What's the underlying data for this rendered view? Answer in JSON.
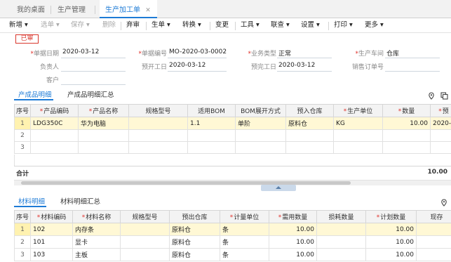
{
  "page_tabs": {
    "home": "我的桌面",
    "production": "生产管理",
    "active": "生产加工单",
    "close": "✕"
  },
  "toolbar": {
    "new": "新增",
    "select_order": "选单",
    "save": "保存",
    "delete": "删除",
    "abandon": "弃审",
    "generate": "生单",
    "convert": "转换",
    "change": "变更",
    "tools": "工具",
    "query": "联查",
    "settings": "设置",
    "print": "打印",
    "more": "更多"
  },
  "status_badge": "已审",
  "form": {
    "doc_date_label": "单据日期",
    "doc_date": "2020-03-12",
    "doc_no_label": "单据编号",
    "doc_no": "MO-2020-03-0002",
    "biz_type_label": "业务类型",
    "biz_type": "正常",
    "workshop_label": "生产车间",
    "workshop": "仓库",
    "owner_label": "负责人",
    "owner": "",
    "plan_start_label": "预开工日",
    "plan_start": "2020-03-12",
    "plan_end_label": "预完工日",
    "plan_end": "2020-03-12",
    "sales_order_label": "销售订单号",
    "sales_order": "",
    "customer_label": "客户",
    "customer": ""
  },
  "product_tabs": {
    "detail": "产成品明细",
    "summary": "产成品明细汇总"
  },
  "product_grid": {
    "headers": [
      "序号",
      "产品编码",
      "产品名称",
      "规格型号",
      "适用BOM",
      "BOM展开方式",
      "预入仓库",
      "生产单位",
      "数量",
      "预"
    ],
    "required": [
      false,
      true,
      true,
      false,
      false,
      false,
      false,
      true,
      true,
      true
    ],
    "rows": [
      [
        "1",
        "LDG350C",
        "华为电脑",
        "",
        "1.1",
        "单阶",
        "原料仓",
        "KG",
        "10.00",
        "2020-"
      ],
      [
        "2",
        "",
        "",
        "",
        "",
        "",
        "",
        "",
        "",
        ""
      ],
      [
        "3",
        "",
        "",
        "",
        "",
        "",
        "",
        "",
        "",
        ""
      ]
    ],
    "total_label": "合计",
    "total_qty": "10.00"
  },
  "material_tabs": {
    "detail": "材料明细",
    "summary": "材料明细汇总"
  },
  "material_grid": {
    "headers": [
      "序号",
      "材料编码",
      "材料名称",
      "规格型号",
      "预出仓库",
      "计量单位",
      "需用数量",
      "损耗数量",
      "计划数量",
      "现存"
    ],
    "required": [
      false,
      true,
      true,
      false,
      false,
      true,
      true,
      false,
      true,
      false
    ],
    "rows": [
      [
        "1",
        "102",
        "内存条",
        "",
        "原料仓",
        "条",
        "10.00",
        "",
        "10.00",
        ""
      ],
      [
        "2",
        "101",
        "显卡",
        "",
        "原料仓",
        "条",
        "10.00",
        "",
        "10.00",
        ""
      ],
      [
        "3",
        "103",
        "主板",
        "",
        "原料仓",
        "条",
        "10.00",
        "",
        "10.00",
        ""
      ]
    ]
  },
  "icons": {
    "location": "location-pin-icon",
    "copy": "copy-icon",
    "dropdown": "chevron-down-icon"
  },
  "colors": {
    "accent": "#1e7bd6",
    "required": "#e0302a",
    "badge": "#d9362c",
    "selected_row": "#fff8d5"
  }
}
